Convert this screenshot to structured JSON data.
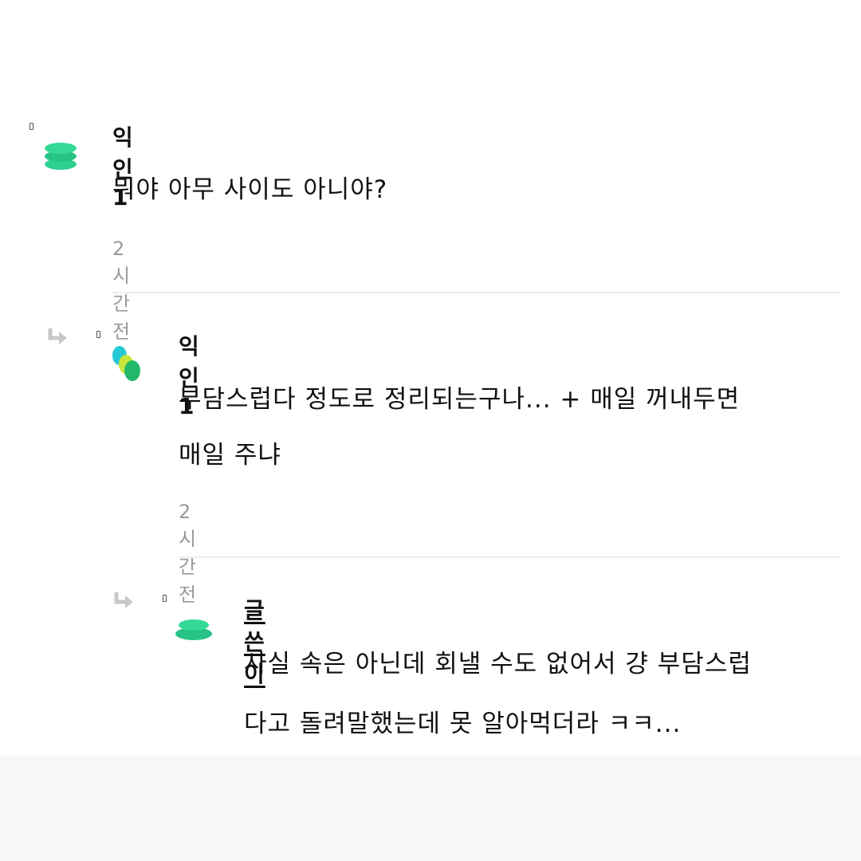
{
  "comments": [
    {
      "author": "익인1",
      "body_lines": [
        "뭐야 아무 사이도 아니야?"
      ],
      "time": "2시간 전",
      "avatar_icon": "green-stacked-discs-icon",
      "is_reply": false
    },
    {
      "author": "익인1",
      "body_lines": [
        "부담스럽다 정도로 정리되는구나... + 매일 꺼내두면",
        "매일 주냐"
      ],
      "time": "2시간 전",
      "avatar_icon": "multicolor-blob-icon",
      "reply_icon": "reply-arrow-icon",
      "is_reply": true
    },
    {
      "author": "글쓴이",
      "body_lines": [
        "사실 속은 아닌데 회낼 수도 없어서 걍 부담스럽",
        "다고 돌려말했는데 못 알아먹더라 ㅋㅋ..."
      ],
      "avatar_icon": "green-stacked-discs-icon",
      "reply_icon": "reply-arrow-icon",
      "is_reply": true,
      "is_original_poster": true
    }
  ],
  "colors": {
    "accent_green": "#2ed08f",
    "time_gray": "#9a9a9a",
    "divider": "#ececec"
  }
}
